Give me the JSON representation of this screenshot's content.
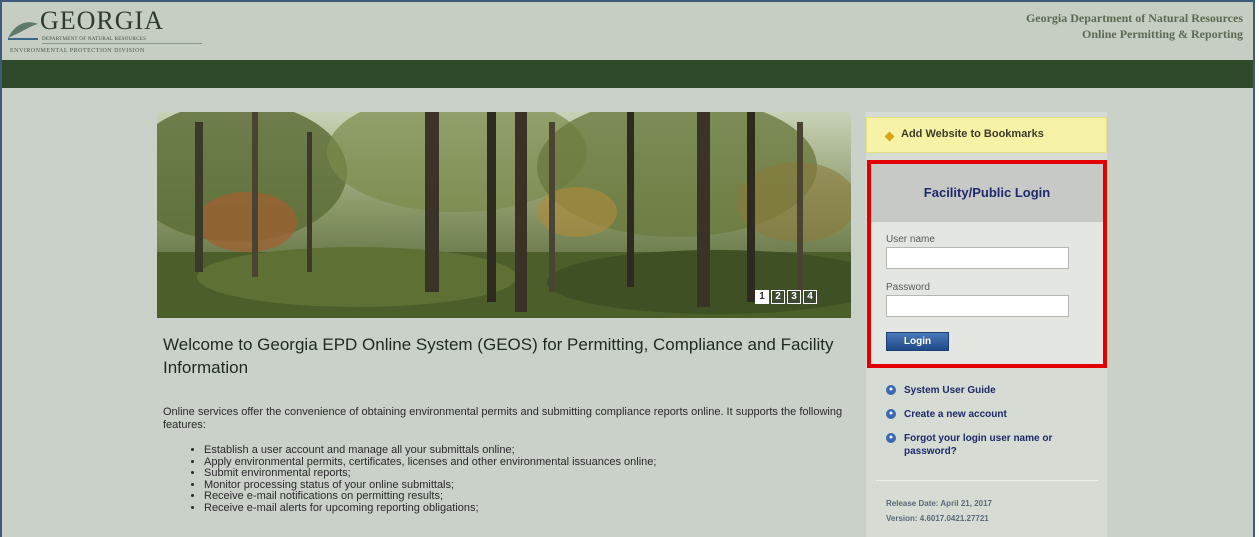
{
  "header": {
    "logo_title": "GEORGIA",
    "logo_subtitle": "DEPARTMENT OF NATURAL RESOURCES",
    "logo_division": "ENVIRONMENTAL PROTECTION DIVISION",
    "org_line1": "Georgia Department of Natural Resources",
    "org_line2": "Online Permitting & Reporting"
  },
  "hero": {
    "slides": [
      "1",
      "2",
      "3",
      "4"
    ],
    "active_slide": "1"
  },
  "main": {
    "welcome": "Welcome to Georgia EPD Online System (GEOS) for Permitting, Compliance and Facility Information",
    "intro": "Online services offer the convenience of obtaining environmental permits and submitting compliance reports online. It supports the following features:",
    "features": [
      "Establish a user account and manage all your submittals online;",
      "Apply environmental permits, certificates, licenses and other environmental issuances online;",
      "Submit environmental reports;",
      "Monitor processing status of your online submittals;",
      "Receive e-mail notifications on permitting results;",
      "Receive e-mail alerts for upcoming reporting obligations;"
    ]
  },
  "sidebar": {
    "bookmark_label": "Add Website to Bookmarks",
    "login_title": "Facility/Public Login",
    "username_label": "User name",
    "username_value": "",
    "password_label": "Password",
    "password_value": "",
    "login_button": "Login",
    "links": [
      "System User Guide",
      "Create a new account",
      "Forgot your login user name or password?"
    ],
    "release_date": "Release Date:  April 21, 2017",
    "version": "Version:  4.6017.0421.27721"
  },
  "colors": {
    "header_bg": "#c6cdc2",
    "nav_bar": "#2f4a2a",
    "page_bg": "#c9d1c8",
    "highlight_border": "#e00000",
    "link_color": "#1e2a6a",
    "bookmark_bg": "#f7f3a6"
  }
}
